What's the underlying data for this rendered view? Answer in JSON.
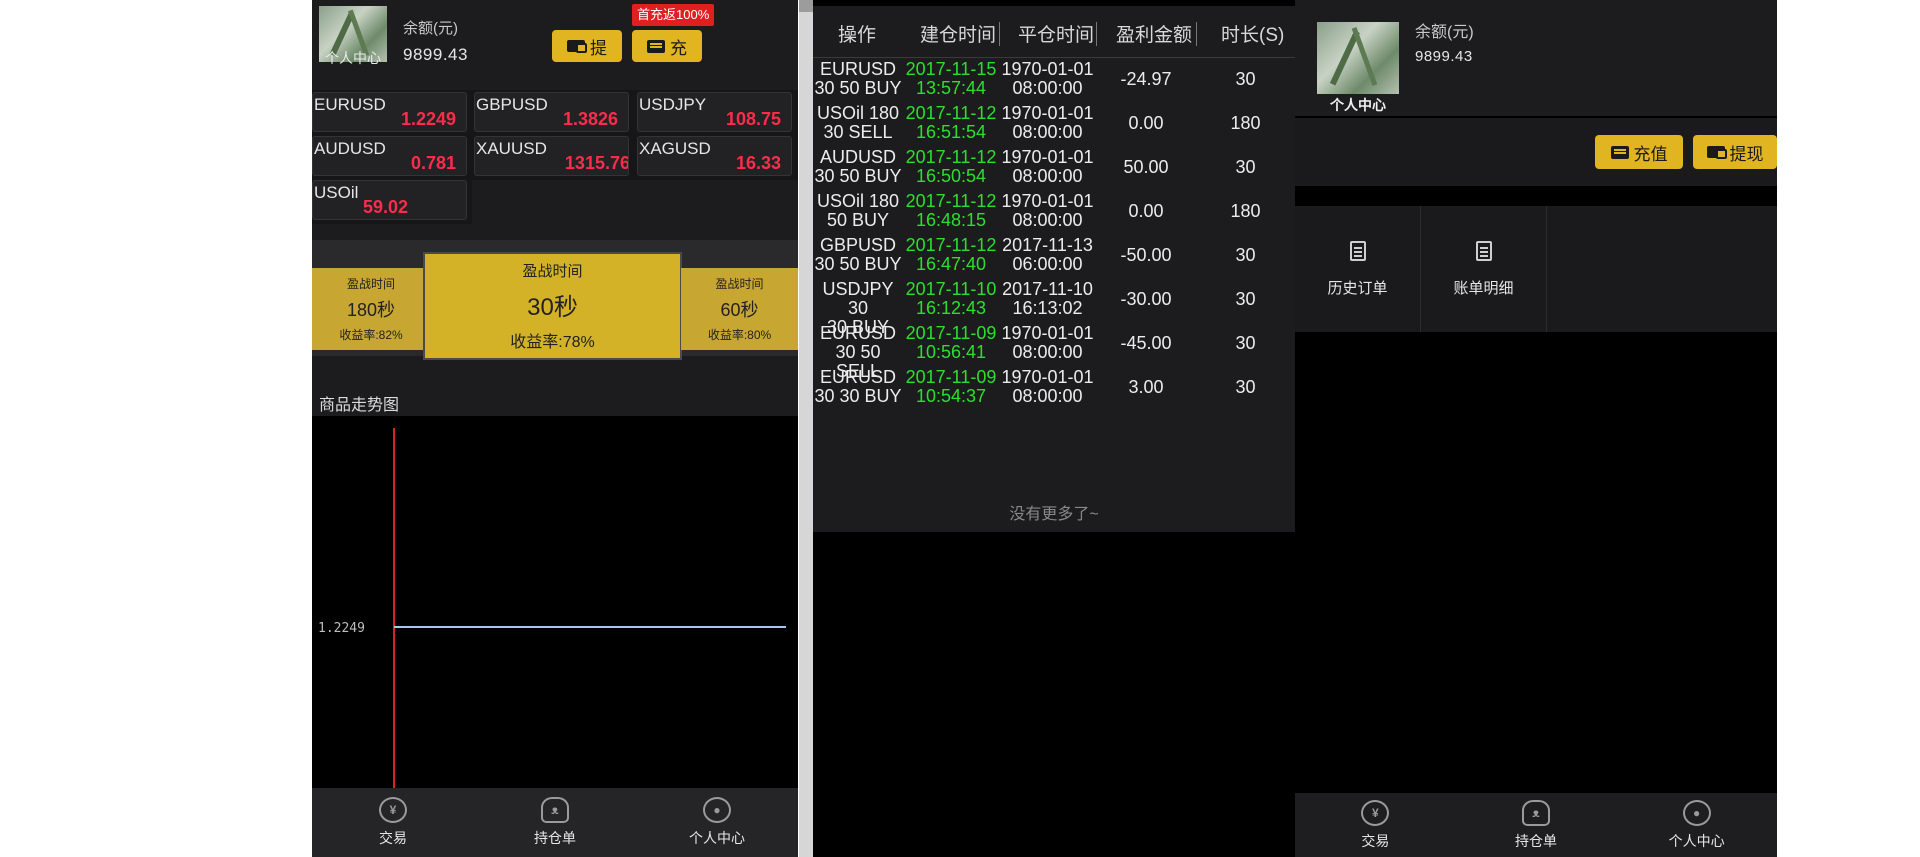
{
  "panel1": {
    "avatar_caption": "个人中心",
    "balance_label": "余额(元)",
    "balance_value": "9899.43",
    "withdraw_label": "提",
    "deposit_label": "充",
    "promo_badge": "首充返100%",
    "quotes": [
      {
        "symbol": "EURUSD",
        "price": "1.2249"
      },
      {
        "symbol": "GBPUSD",
        "price": "1.3826"
      },
      {
        "symbol": "USDJPY",
        "price": "108.75"
      },
      {
        "symbol": "AUDUSD",
        "price": "0.781"
      },
      {
        "symbol": "XAUUSD",
        "price": "1315.76"
      },
      {
        "symbol": "XAGUSD",
        "price": "16.33"
      },
      {
        "symbol": "USOil",
        "price": "59.02"
      }
    ],
    "time_cards": [
      {
        "label": "盈战时间",
        "time": "180秒",
        "rate": "收益率:82%"
      },
      {
        "label": "盈战时间",
        "time": "30秒",
        "rate": "收益率:78%"
      },
      {
        "label": "盈战时间",
        "time": "60秒",
        "rate": "收益率:80%"
      }
    ],
    "chart_title": "商品走势图",
    "chart_price_label": "1.2249"
  },
  "tabs": [
    {
      "label": "交易",
      "icon": "yuan-icon"
    },
    {
      "label": "持仓单",
      "icon": "users-icon"
    },
    {
      "label": "个人中心",
      "icon": "user-icon"
    }
  ],
  "panel2": {
    "headers": [
      "操作",
      "建仓时间",
      "平仓时间",
      "盈利金额",
      "时长(S)"
    ],
    "rows": [
      {
        "op1": "EURUSD",
        "op2": "30 50 BUY",
        "open_date": "2017-11-15",
        "open_time": "13:57:44",
        "close_date": "1970-01-01",
        "close_time": "08:00:00",
        "profit": "-24.97",
        "duration": "30"
      },
      {
        "op1": "USOil 180",
        "op2": "30 SELL",
        "open_date": "2017-11-12",
        "open_time": "16:51:54",
        "close_date": "1970-01-01",
        "close_time": "08:00:00",
        "profit": "0.00",
        "duration": "180"
      },
      {
        "op1": "AUDUSD",
        "op2": "30 50 BUY",
        "open_date": "2017-11-12",
        "open_time": "16:50:54",
        "close_date": "1970-01-01",
        "close_time": "08:00:00",
        "profit": "50.00",
        "duration": "30"
      },
      {
        "op1": "USOil 180",
        "op2": "50 BUY",
        "open_date": "2017-11-12",
        "open_time": "16:48:15",
        "close_date": "1970-01-01",
        "close_time": "08:00:00",
        "profit": "0.00",
        "duration": "180"
      },
      {
        "op1": "GBPUSD",
        "op2": "30 50 BUY",
        "open_date": "2017-11-12",
        "open_time": "16:47:40",
        "close_date": "2017-11-13",
        "close_time": "06:00:00",
        "profit": "-50.00",
        "duration": "30"
      },
      {
        "op1": "USDJPY 30",
        "op2": "30 BUY",
        "open_date": "2017-11-10",
        "open_time": "16:12:43",
        "close_date": "2017-11-10",
        "close_time": "16:13:02",
        "profit": "-30.00",
        "duration": "30"
      },
      {
        "op1": "EURUSD",
        "op2": "30 50 SELL",
        "open_date": "2017-11-09",
        "open_time": "10:56:41",
        "close_date": "1970-01-01",
        "close_time": "08:00:00",
        "profit": "-45.00",
        "duration": "30"
      },
      {
        "op1": "EURUSD",
        "op2": "30 30 BUY",
        "open_date": "2017-11-09",
        "open_time": "10:54:37",
        "close_date": "1970-01-01",
        "close_time": "08:00:00",
        "profit": "3.00",
        "duration": "30"
      }
    ],
    "no_more": "没有更多了~"
  },
  "panel3": {
    "avatar_caption": "个人中心",
    "balance_label": "余额(元)",
    "balance_value": "9899.43",
    "deposit_label": "充值",
    "withdraw_label": "提现",
    "grid": [
      {
        "label": "历史订单",
        "icon": "history-order-icon"
      },
      {
        "label": "账单明细",
        "icon": "bill-detail-icon"
      }
    ]
  },
  "colors": {
    "gold": "#e0b521",
    "price_red": "#ff2b4a",
    "time_green": "#2be02b",
    "chart_line": "#a8c8f0",
    "chart_cursor": "#e02020"
  }
}
